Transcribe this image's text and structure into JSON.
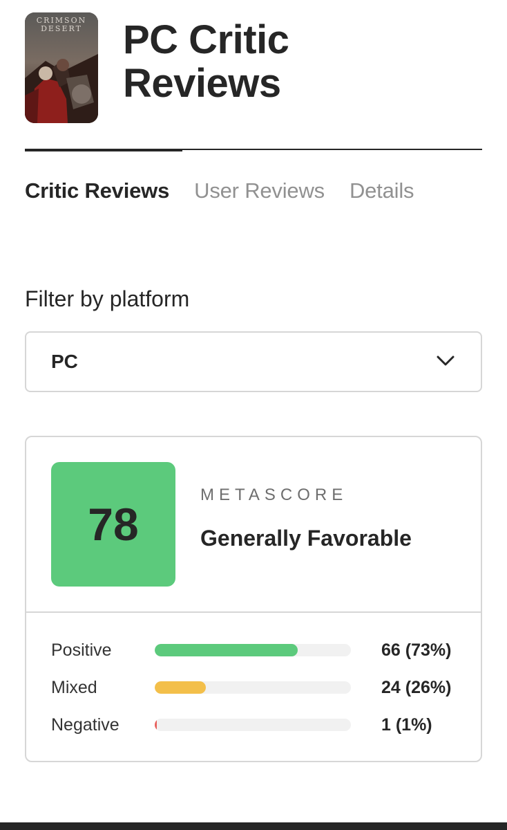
{
  "header": {
    "cover_title": "CRIMSON DESERT",
    "title": "PC Critic Reviews"
  },
  "tabs": [
    {
      "label": "Critic Reviews",
      "active": true
    },
    {
      "label": "User Reviews",
      "active": false
    },
    {
      "label": "Details",
      "active": false
    }
  ],
  "filter": {
    "label": "Filter by platform",
    "selected": "PC",
    "icon": "chevron-down-icon"
  },
  "metascore": {
    "score": "78",
    "label": "METASCORE",
    "verdict": "Generally Favorable",
    "color": "#5cca7c"
  },
  "distribution": [
    {
      "label": "Positive",
      "count_text": "66 (73%)",
      "percent": 73,
      "color": "#5cca7c"
    },
    {
      "label": "Mixed",
      "count_text": "24 (26%)",
      "percent": 26,
      "color": "#f3bf4a"
    },
    {
      "label": "Negative",
      "count_text": "1 (1%)",
      "percent": 1,
      "color": "#e8615d"
    }
  ]
}
